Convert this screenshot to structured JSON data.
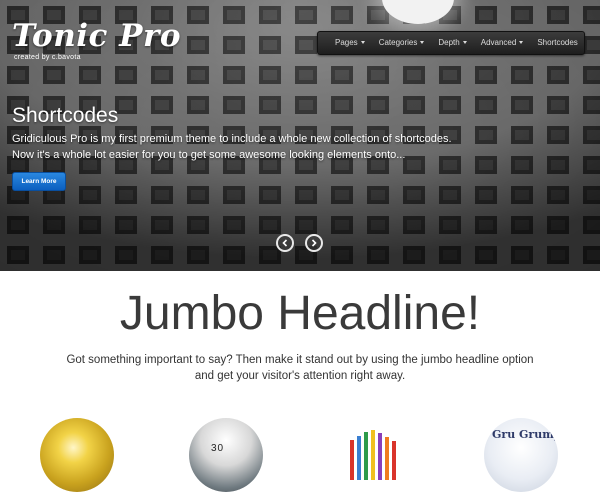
{
  "brand": {
    "name": "Tonic Pro",
    "tagline": "created by c.bavota"
  },
  "nav": {
    "items": [
      {
        "label": "Pages",
        "has_dropdown": true
      },
      {
        "label": "Categories",
        "has_dropdown": true
      },
      {
        "label": "Depth",
        "has_dropdown": true
      },
      {
        "label": "Advanced",
        "has_dropdown": true
      },
      {
        "label": "Shortcodes",
        "has_dropdown": false
      }
    ]
  },
  "slider": {
    "title": "Shortcodes",
    "text_line1": "Gridiculous Pro is my first premium theme to include a whole new collection of shortcodes.",
    "text_line2": "Now it's a whole lot easier for you to get some awesome looking elements onto...",
    "button_label": "Learn More",
    "prev_icon": "chevron-left-icon",
    "next_icon": "chevron-right-icon"
  },
  "jumbo": {
    "headline": "Jumbo Headline!",
    "sub_line1": "Got something important to say? Then make it stand out by using the jumbo headline option",
    "sub_line2": "and get your visitor's attention right away."
  },
  "thumbs": {
    "t2_text": "30",
    "t4_text": "Gru Grump"
  },
  "colors": {
    "button_blue": "#1a73d9",
    "nav_bg": "#2a2a2a",
    "headline": "#3a3a3a"
  }
}
